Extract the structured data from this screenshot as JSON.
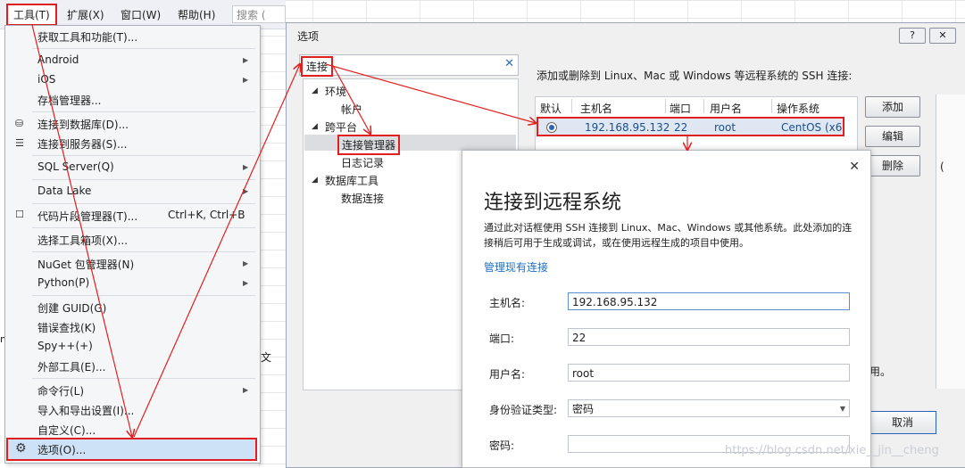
{
  "menubar": {
    "items": [
      {
        "label": "工具(T)"
      },
      {
        "label": "扩展(X)"
      },
      {
        "label": "窗口(W)"
      },
      {
        "label": "帮助(H)"
      }
    ],
    "search_placeholder": "搜索 ("
  },
  "tools_menu": {
    "items": [
      {
        "label": "获取工具和功能(T)..."
      },
      {
        "label": "Android"
      },
      {
        "label": "iOS"
      },
      {
        "label": "存档管理器..."
      },
      {
        "label": "连接到数据库(D)..."
      },
      {
        "label": "连接到服务器(S)..."
      },
      {
        "label": "SQL Server(Q)"
      },
      {
        "label": "Data Lake"
      },
      {
        "label": "代码片段管理器(T)...",
        "shortcut": "Ctrl+K, Ctrl+B"
      },
      {
        "label": "选择工具箱项(X)..."
      },
      {
        "label": "NuGet 包管理器(N)"
      },
      {
        "label": "Python(P)"
      },
      {
        "label": "创建 GUID(G)"
      },
      {
        "label": "错误查找(K)"
      },
      {
        "label": "Spy++(+)"
      },
      {
        "label": "外部工具(E)..."
      },
      {
        "label": "命令行(L)"
      },
      {
        "label": "导入和导出设置(I)..."
      },
      {
        "label": "自定义(C)..."
      },
      {
        "label": "选项(O)..."
      }
    ]
  },
  "options_dialog": {
    "title": "选项",
    "help_btn": "?",
    "close_btn": "✕",
    "search_value": "连接",
    "tree": {
      "env": "环境",
      "account": "帐户",
      "cross": "跨平台",
      "conn_mgr": "连接管理器",
      "log": "日志记录",
      "db_tools": "数据库工具",
      "data_conn": "数据连接"
    },
    "description": "添加或删除到 Linux、Mac 或 Windows 等远程系统的 SSH 连接:",
    "columns": [
      "默认",
      "主机名",
      "端口",
      "用户名",
      "操作系统"
    ],
    "row": {
      "host": "192.168.95.132",
      "port": "22",
      "user": "root",
      "os": "CentOS (x6"
    },
    "buttons": {
      "add": "添加",
      "edit": "编辑",
      "remove": "删除",
      "cancel": "取消"
    },
    "bottom_fragment": "用。",
    "side_char": "("
  },
  "remote_dialog": {
    "close": "✕",
    "title": "连接到远程系统",
    "description": "通过此对话框使用 SSH 连接到 Linux、Mac、Windows 或其他系统。此处添加的连接稍后可用于生成或调试，或在使用远程生成的项目中使用。",
    "manage_link": "管理现有连接",
    "fields": {
      "host_label": "主机名:",
      "host_value": "192.168.95.132",
      "port_label": "端口:",
      "port_value": "22",
      "user_label": "用户名:",
      "user_value": "root",
      "auth_label": "身份验证类型:",
      "auth_value": "密码",
      "password_label": "密码:",
      "password_value": ""
    }
  },
  "background": {
    "partial_char_1": "文",
    "partial_char_2": "n"
  },
  "watermark": "https://blog.csdn.net/xie__jin__cheng"
}
